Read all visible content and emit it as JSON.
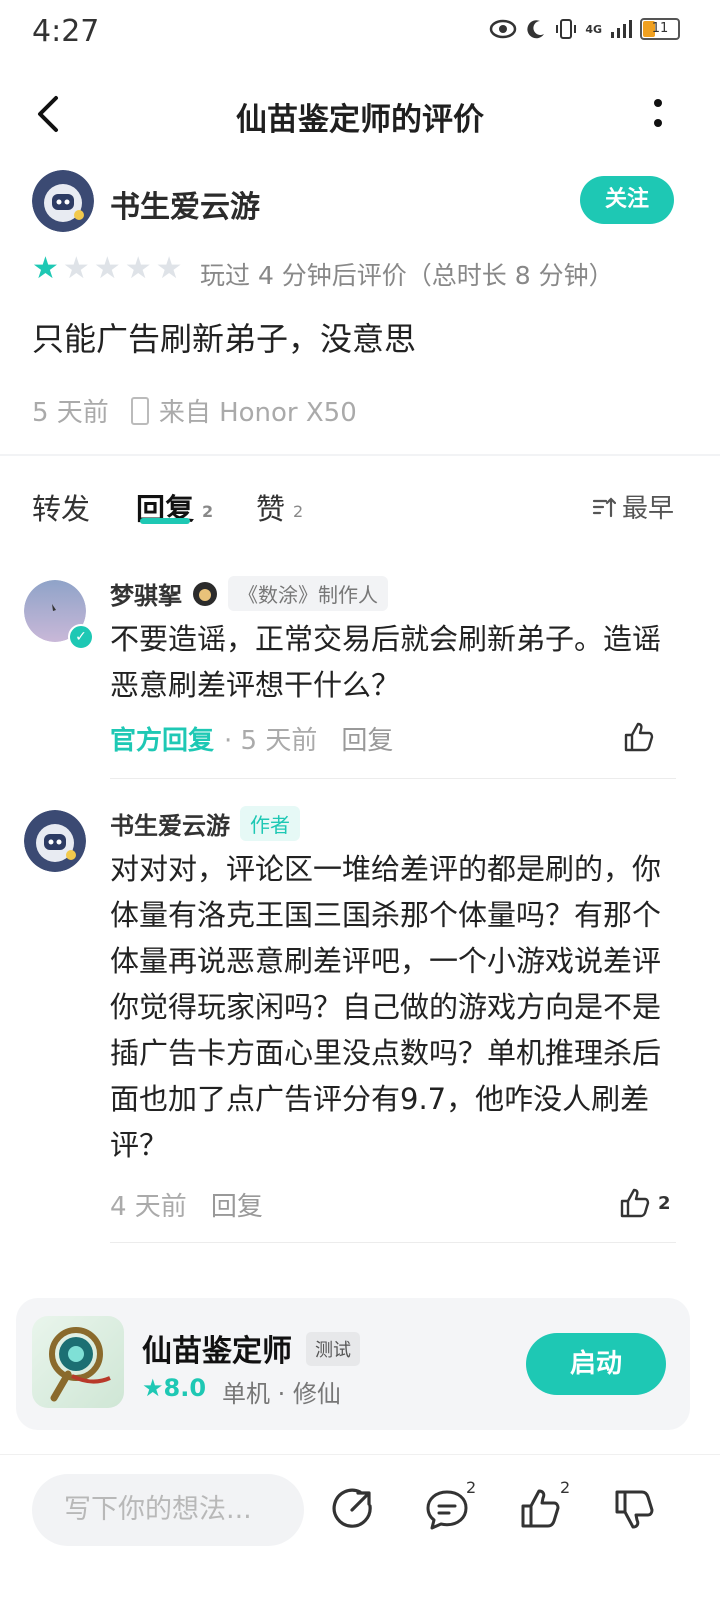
{
  "status": {
    "time": "4:27",
    "network": "4G",
    "battery": "11"
  },
  "header": {
    "title": "仙苗鉴定师的评价"
  },
  "review": {
    "author": "书生爱云游",
    "follow_label": "关注",
    "rating": 1,
    "rating_max": 5,
    "play_info": "玩过 4 分钟后评价（总时长 8 分钟）",
    "text": "只能广告刷新弟子，没意思",
    "time": "5 天前",
    "device": "来自 Honor X50"
  },
  "tabs": {
    "repost": "转发",
    "reply": "回复",
    "reply_count": "2",
    "like": "赞",
    "like_count": "2",
    "sort": "最早"
  },
  "replies": [
    {
      "name": "梦骐挐",
      "badge": "《数涂》制作人",
      "text": "不要造谣，正常交易后就会刷新弟子。造谣恶意刷差评想干什么？",
      "official": "官方回复",
      "time": "· 5 天前",
      "reply_label": "回复"
    },
    {
      "name": "书生爱云游",
      "badge": "作者",
      "text": "对对对，评论区一堆给差评的都是刷的，你体量有洛克王国三国杀那个体量吗？有那个体量再说恶意刷差评吧，一个小游戏说差评你觉得玩家闲吗？自己做的游戏方向是不是插广告卡方面心里没点数吗？单机推理杀后面也加了点广告评分有9.7，他咋没人刷差评？",
      "time": "4 天前",
      "reply_label": "回复",
      "likes": "2"
    }
  ],
  "game": {
    "name": "仙苗鉴定师",
    "badge": "测试",
    "score": "★8.0",
    "genre": "单机 · 修仙",
    "launch_label": "启动"
  },
  "bottom": {
    "placeholder": "写下你的想法...",
    "comment_count": "2",
    "like_count": "2"
  },
  "colors": {
    "accent": "#1ec8b4"
  }
}
